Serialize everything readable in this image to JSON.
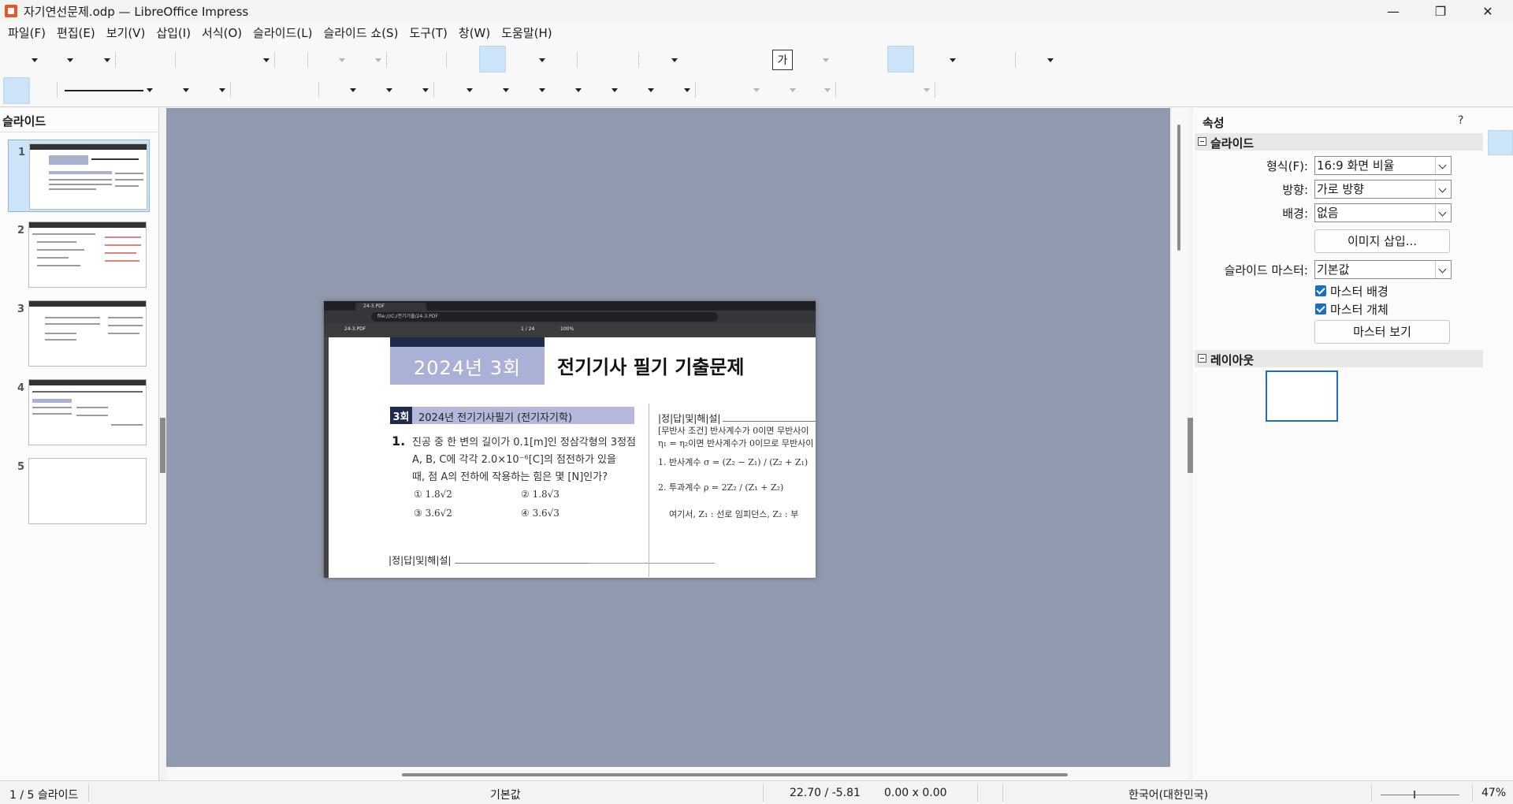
{
  "window": {
    "title": "자기연선문제.odp — LibreOffice Impress",
    "minimize_glyph": "—",
    "maximize_glyph": "❐",
    "close_glyph": "✕"
  },
  "menu": [
    "파일(F)",
    "편집(E)",
    "보기(V)",
    "삽입(I)",
    "서식(O)",
    "슬라이드(L)",
    "슬라이드 쇼(S)",
    "도구(T)",
    "창(W)",
    "도움말(H)"
  ],
  "toolbar": {
    "fontwork_glyph": "가"
  },
  "slide_pane": {
    "title": "슬라이드",
    "slides": [
      "1",
      "2",
      "3",
      "4",
      "5"
    ],
    "selected": "1"
  },
  "slide_content": {
    "browser_tab": "24-3.PDF",
    "browser_url": "file:///C:/전기기출/24-3.PDF",
    "pdf_name": "24-3.PDF",
    "pdf_page": "1 / 24",
    "pdf_zoom": "100%",
    "year_label": "2024년 3회",
    "title": "전기기사 필기 기출문제",
    "section_num": "3회",
    "section_title": "2024년 전기기사필기 (전기자기학)",
    "q_num": "1.",
    "q_line1": "진공 중 한 변의 길이가 0.1[m]인 정삼각형의 3정점",
    "q_line2": "A, B, C에 각각 2.0×10⁻⁶[C]의 점전하가 있을",
    "q_line3": "때, 점 A의 전하에 작용하는 힘은 몇 [N]인가?",
    "choices": [
      "① 1.8√2",
      "② 1.8√3",
      "③ 3.6√2",
      "④ 3.6√3"
    ],
    "answer_header": "|정|답|및|해|설|",
    "right_answer_header": "|정|답|및|해|설|",
    "right_line1": "[무반사 조건] 반사계수가 0이면 무반사이",
    "right_line2": "η₁ = η₂이면 반사계수가 0이므로 무반사이",
    "right_line3": "1. 반사계수 σ = (Z₂ − Z₁) / (Z₂ + Z₁)",
    "right_line4": "2. 투과계수 ρ = 2Z₂ / (Z₁ + Z₂)",
    "right_line5": "여기서, Z₁ : 선로 임피던스, Z₂ : 부"
  },
  "sidebar": {
    "title": "속성",
    "help": "?",
    "slide_section": "슬라이드",
    "format_label": "형식(F):",
    "format_value": "16:9 화면 비율",
    "orientation_label": "방향:",
    "orientation_value": "가로 방향",
    "background_label": "배경:",
    "background_value": "없음",
    "insert_image_button": "이미지 삽입...",
    "master_label": "슬라이드 마스터:",
    "master_value": "기본값",
    "master_background": "마스터 배경",
    "master_objects": "마스터 개체",
    "master_view_button": "마스터 보기",
    "layout_section": "레이아웃"
  },
  "status": {
    "slide_count": "1 / 5 슬라이드",
    "master_name": "기본값",
    "position": "22.70 / -5.81",
    "size": "0.00 x 0.00",
    "language": "한국어(대한민국)",
    "zoom": "47%"
  }
}
